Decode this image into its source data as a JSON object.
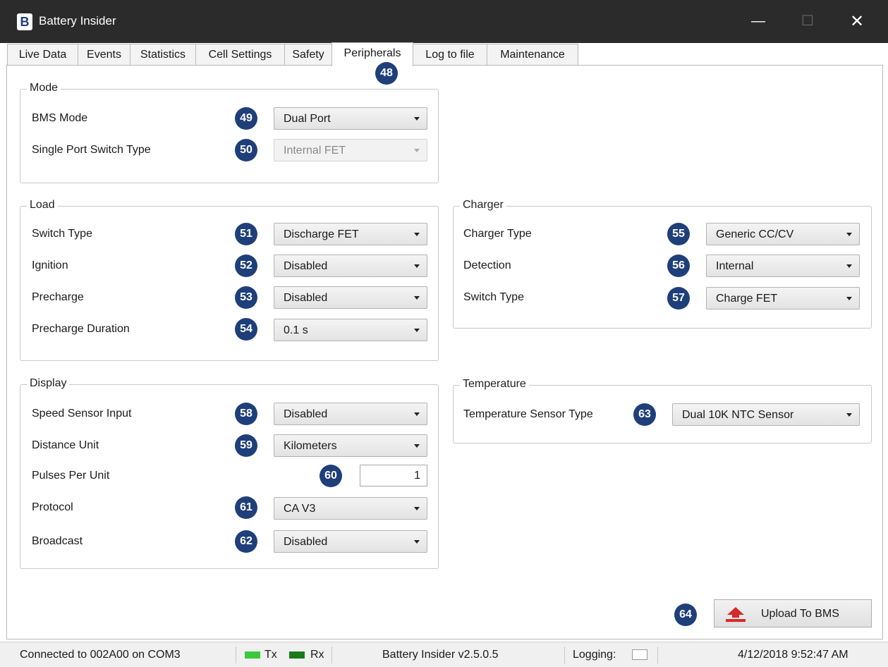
{
  "window": {
    "title": "Battery Insider",
    "app_icon_glyph": "B",
    "controls": {
      "minimize": "—",
      "maximize": "☐",
      "close": "✕"
    }
  },
  "tabs": [
    {
      "label": "Live Data"
    },
    {
      "label": "Events"
    },
    {
      "label": "Statistics"
    },
    {
      "label": "Cell Settings"
    },
    {
      "label": "Safety"
    },
    {
      "label": "Peripherals",
      "active": true
    },
    {
      "label": "Log to file"
    },
    {
      "label": "Maintenance"
    }
  ],
  "badges": {
    "b48": "48",
    "b49": "49",
    "b50": "50",
    "b51": "51",
    "b52": "52",
    "b53": "53",
    "b54": "54",
    "b55": "55",
    "b56": "56",
    "b57": "57",
    "b58": "58",
    "b59": "59",
    "b60": "60",
    "b61": "61",
    "b62": "62",
    "b63": "63",
    "b64": "64"
  },
  "mode": {
    "title": "Mode",
    "bms_mode": {
      "label": "BMS Mode",
      "value": "Dual Port"
    },
    "single_port_switch": {
      "label": "Single Port Switch Type",
      "value": "Internal FET",
      "disabled": true
    }
  },
  "load": {
    "title": "Load",
    "switch_type": {
      "label": "Switch Type",
      "value": "Discharge FET"
    },
    "ignition": {
      "label": "Ignition",
      "value": "Disabled"
    },
    "precharge": {
      "label": "Precharge",
      "value": "Disabled"
    },
    "precharge_duration": {
      "label": "Precharge Duration",
      "value": "0.1 s"
    }
  },
  "charger": {
    "title": "Charger",
    "charger_type": {
      "label": "Charger Type",
      "value": "Generic CC/CV"
    },
    "detection": {
      "label": "Detection",
      "value": "Internal"
    },
    "switch_type": {
      "label": "Switch Type",
      "value": "Charge FET"
    }
  },
  "display": {
    "title": "Display",
    "speed_sensor": {
      "label": "Speed Sensor Input",
      "value": "Disabled"
    },
    "distance_unit": {
      "label": "Distance Unit",
      "value": "Kilometers"
    },
    "pulses_per_unit": {
      "label": "Pulses Per Unit",
      "value": "1"
    },
    "protocol": {
      "label": "Protocol",
      "value": "CA V3"
    },
    "broadcast": {
      "label": "Broadcast",
      "value": "Disabled"
    }
  },
  "temperature": {
    "title": "Temperature",
    "sensor_type": {
      "label": "Temperature Sensor Type",
      "value": "Dual 10K NTC Sensor"
    }
  },
  "upload_button": {
    "label": "Upload To BMS",
    "icon": "upload-icon"
  },
  "statusbar": {
    "connection": "Connected to 002A00 on COM3",
    "tx_label": "Tx",
    "rx_label": "Rx",
    "version": "Battery Insider v2.5.0.5",
    "logging_label": "Logging:",
    "datetime": "4/12/2018 9:52:47 AM"
  },
  "colors": {
    "titlebar": "#2b2b2b",
    "badge": "#1e3f7a",
    "tx_led": "#3cc83c",
    "rx_led": "#1a7a1a",
    "upload_icon": "#d42a2a"
  }
}
